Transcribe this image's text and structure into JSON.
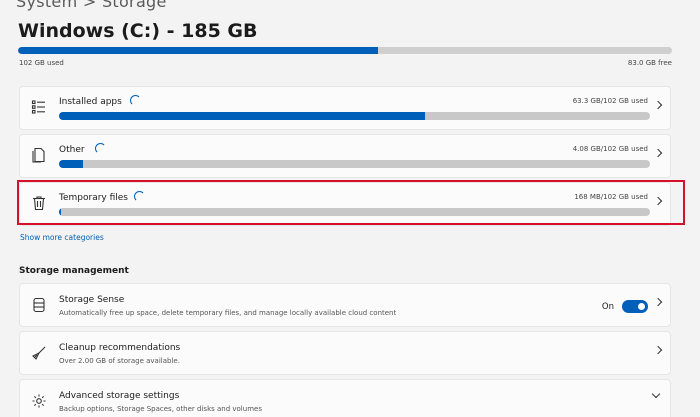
{
  "breadcrumb": {
    "text": "System  >  Storage"
  },
  "drive": {
    "title": "Windows (C:) - 185 GB",
    "used_label": "102 GB used",
    "free_label": "83.0 GB free",
    "used_fraction": 0.55
  },
  "categories": [
    {
      "name": "Installed apps",
      "size": "63.3 GB/102 GB used",
      "fraction": 0.62,
      "icon": "list-icon"
    },
    {
      "name": "Other",
      "size": "4.08 GB/102 GB used",
      "fraction": 0.04,
      "icon": "document-icon"
    },
    {
      "name": "Temporary files",
      "size": "168 MB/102 GB used",
      "fraction": 0.003,
      "icon": "trash-icon"
    }
  ],
  "show_more": "Show more categories",
  "storage_management": {
    "title": "Storage management",
    "items": [
      {
        "name": "Storage Sense",
        "description": "Automatically free up space, delete temporary files, and manage locally available cloud content",
        "toggle_label": "On",
        "toggle_on": true
      },
      {
        "name": "Cleanup recommendations",
        "description": "Over 2.00 GB of storage available."
      },
      {
        "name": "Advanced storage settings",
        "description": "Backup options, Storage Spaces, other disks and volumes"
      }
    ]
  },
  "colors": {
    "accent": "#005fb8",
    "highlight": "#d4102a"
  }
}
